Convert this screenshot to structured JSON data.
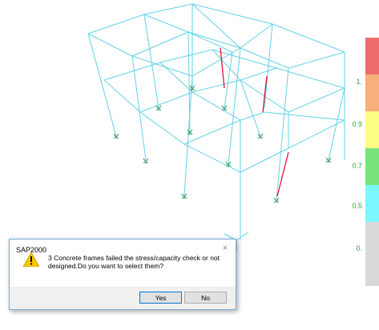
{
  "window": {
    "app": "SAP2000"
  },
  "legend": {
    "ticks": [
      "1.",
      "0.9",
      "0.7",
      "0.5",
      "0."
    ],
    "colors": [
      "#f06c6c",
      "#f7b07a",
      "#fdfd84",
      "#78e37a",
      "#7cf7ff",
      "#d9d9d9"
    ]
  },
  "model": {
    "frame_color": "#5fd3e8",
    "failed_frame_color": "#e0002a",
    "support_color": "#2a8a4a",
    "failed_frames_count": 3
  },
  "dialog": {
    "title": "SAP2000",
    "close_label": "×",
    "message": "3 Concrete frames failed the stress/capacity check or not designed.Do you want to select them?",
    "yes_label": "Yes",
    "no_label": "No"
  }
}
